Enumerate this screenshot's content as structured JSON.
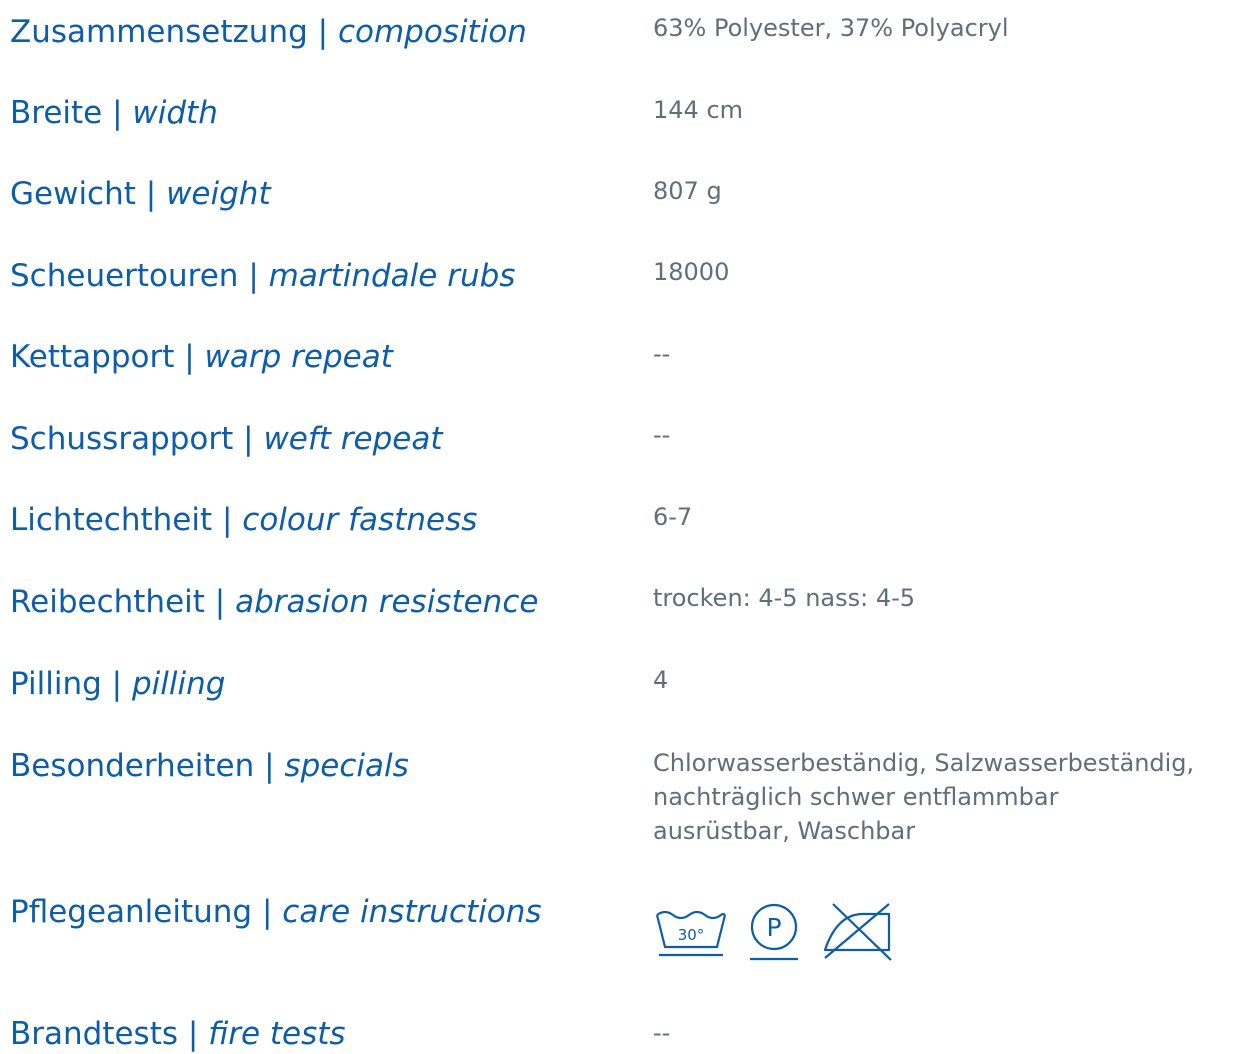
{
  "rows": [
    {
      "de": "Zusammensetzung",
      "en": "composition",
      "value": "63% Polyester, 37% Polyacryl"
    },
    {
      "de": "Breite",
      "en": "width",
      "value": "144 cm"
    },
    {
      "de": "Gewicht",
      "en": "weight",
      "value": "807 g"
    },
    {
      "de": "Scheuertouren",
      "en": "martindale rubs",
      "value": "18000"
    },
    {
      "de": "Kettapport",
      "en": "warp repeat",
      "value": "--"
    },
    {
      "de": "Schussrapport",
      "en": "weft repeat",
      "value": "--"
    },
    {
      "de": "Lichtechtheit",
      "en": "colour fastness",
      "value": "6-7"
    },
    {
      "de": "Reibechtheit",
      "en": "abrasion resistence",
      "value": "trocken: 4-5 nass: 4-5"
    },
    {
      "de": "Pilling",
      "en": "pilling",
      "value": "4"
    },
    {
      "de": "Besonderheiten",
      "en": "specials",
      "value_lines": [
        "Chlorwasserbeständig, Salzwasserbeständig,",
        "nachträglich schwer entflammbar",
        "ausrüstbar, Waschbar"
      ]
    },
    {
      "de": "Pflegeanleitung",
      "en": "care instructions"
    },
    {
      "de": "Brandtests",
      "en": "fire tests",
      "value": "--"
    }
  ],
  "separator": " | ",
  "care_icons": [
    {
      "icon": "wash-30-icon",
      "text": "30°"
    },
    {
      "icon": "dry-clean-p-icon",
      "text": "P"
    },
    {
      "icon": "do-not-iron-icon"
    }
  ],
  "colors": {
    "label": "#0e5da8",
    "value": "#5f6f7a",
    "icon_stroke": "#0e5da8"
  }
}
